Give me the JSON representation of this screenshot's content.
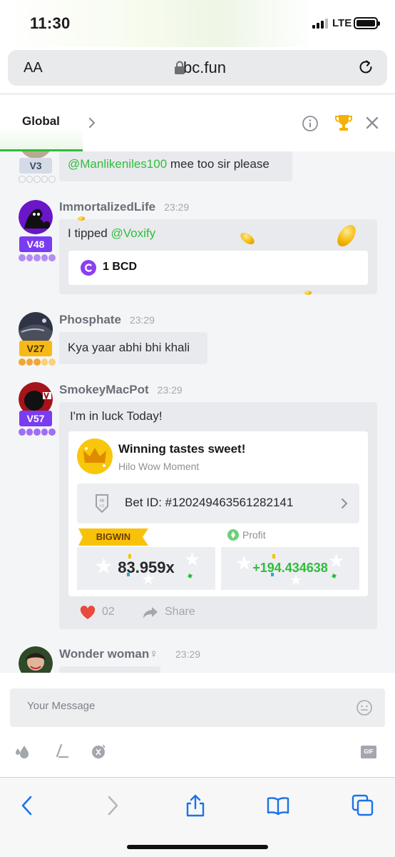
{
  "status_bar": {
    "time": "11:30",
    "network": "LTE"
  },
  "url_bar": {
    "aa": "AA",
    "url": "bc.fun"
  },
  "chat_header": {
    "tab": "Global"
  },
  "messages": [
    {
      "vip": "V3",
      "mention": "@Manlikeniles100",
      "text": " mee too sir please"
    },
    {
      "user": "ImmortalizedLife",
      "time": "23:29",
      "vip": "V48",
      "text": "I tipped ",
      "mention": "@Voxify",
      "tip_amount": "1 BCD"
    },
    {
      "user": "Phosphate",
      "time": "23:29",
      "vip": "V27",
      "text": "Kya yaar abhi bhi khali"
    },
    {
      "user": "SmokeyMacPot",
      "time": "23:29",
      "vip": "V57",
      "text": "I'm in luck Today!",
      "share_card": {
        "title": "Winning tastes sweet!",
        "subtitle": "Hilo Wow Moment",
        "bet_id": "Bet ID: #120249463561282141",
        "badge": "BIGWIN",
        "multiplier": "83.959x",
        "profit_label": "Profit",
        "profit": "+194.434638"
      },
      "likes": "02",
      "share_label": "Share"
    },
    {
      "user": "Wonder woman",
      "gender": "♀",
      "time": "23:29"
    }
  ],
  "composer": {
    "placeholder": "Your Message",
    "gif_label": "GIF"
  },
  "colors": {
    "accent": "#2fbd3c",
    "vip_blue": "#a9b4c8",
    "vip_purple": "#7a3cf0",
    "vip_gold": "#f6b917",
    "like": "#e94a3c"
  }
}
